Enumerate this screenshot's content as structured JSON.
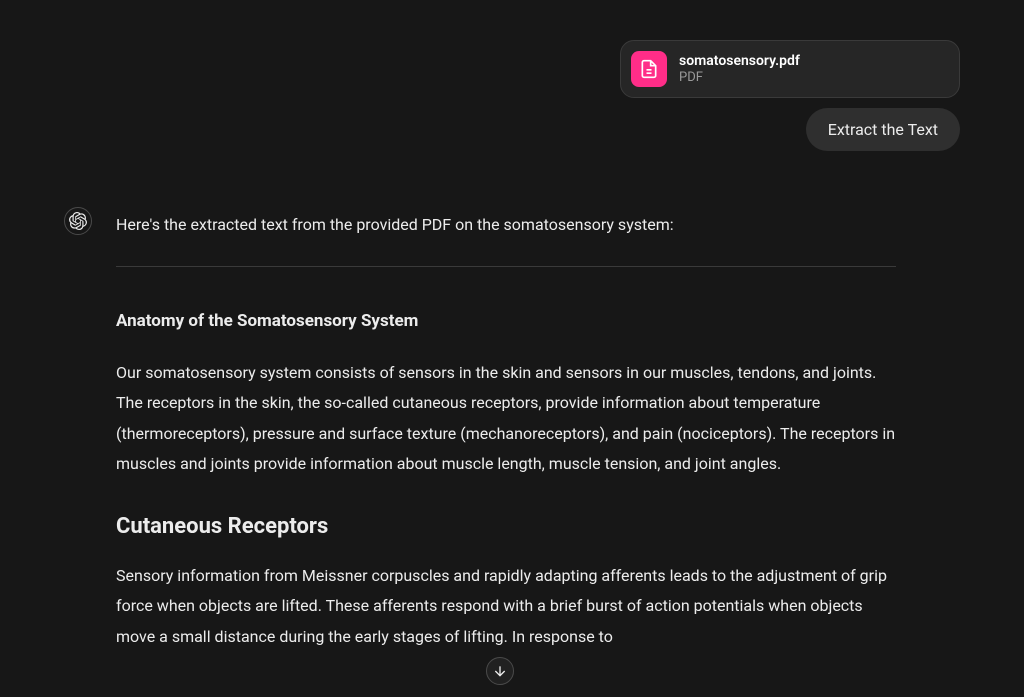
{
  "user_turn": {
    "attachment": {
      "file_name": "somatosensory.pdf",
      "file_type": "PDF"
    },
    "message": "Extract the Text"
  },
  "assistant_turn": {
    "intro": "Here's the extracted text from the provided PDF on the somatosensory system:",
    "sections": {
      "anatomy": {
        "title": "Anatomy of the Somatosensory System",
        "body": "Our somatosensory system consists of sensors in the skin and sensors in our muscles, tendons, and joints. The receptors in the skin, the so-called cutaneous receptors, provide information about temperature (thermoreceptors), pressure and surface texture (mechanoreceptors), and pain (nociceptors). The receptors in muscles and joints provide information about muscle length, muscle tension, and joint angles."
      },
      "cutaneous": {
        "title": "Cutaneous Receptors",
        "body": "Sensory information from Meissner corpuscles and rapidly adapting afferents leads to the adjustment of grip force when objects are lifted. These afferents respond with a brief burst of action potentials when objects move a small distance during the early stages of lifting. In response to"
      }
    }
  }
}
